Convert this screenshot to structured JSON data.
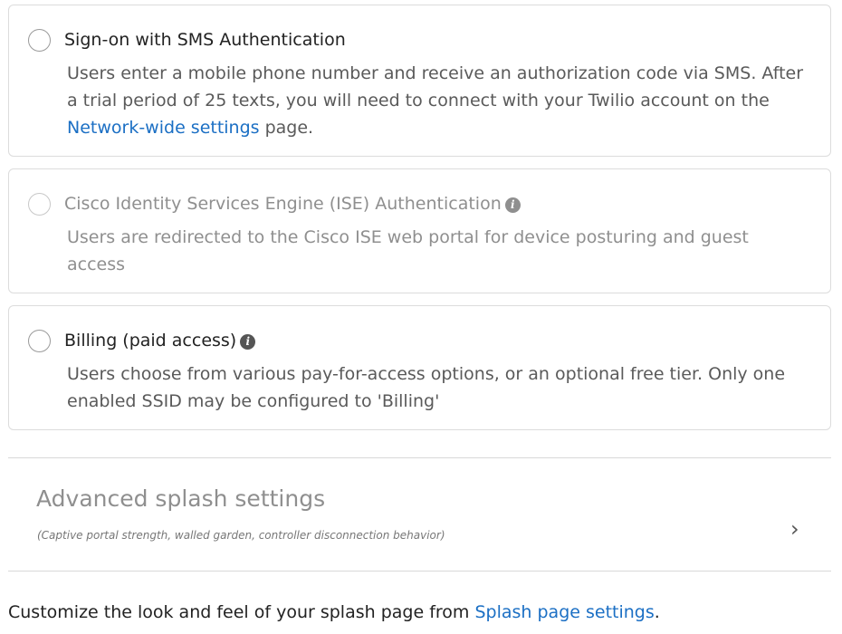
{
  "options": {
    "sms": {
      "title": "Sign-on with SMS Authentication",
      "desc_before_link": "Users enter a mobile phone number and receive an authorization code via SMS. After a trial period of 25 texts, you will need to connect with your Twilio account on the ",
      "link": "Network-wide settings",
      "desc_after_link": " page."
    },
    "ise": {
      "title": "Cisco Identity Services Engine (ISE) Authentication",
      "info_icon": "i",
      "desc": "Users are redirected to the Cisco ISE web portal for device posturing and guest access"
    },
    "billing": {
      "title": "Billing (paid access)",
      "info_icon": "i",
      "desc": "Users choose from various pay-for-access options, or an optional free tier. Only one enabled SSID may be configured to 'Billing'"
    }
  },
  "advanced": {
    "title": "Advanced splash settings",
    "subtitle": "(Captive portal strength, walled garden, controller disconnection behavior)",
    "chevron": "›"
  },
  "footer": {
    "text_before_link": "Customize the look and feel of your splash page from ",
    "link": "Splash page settings",
    "text_after_link": "."
  },
  "colors": {
    "link": "#1b6fc4",
    "disabled_text": "#8f8f8f",
    "border": "#dcdcdc"
  }
}
